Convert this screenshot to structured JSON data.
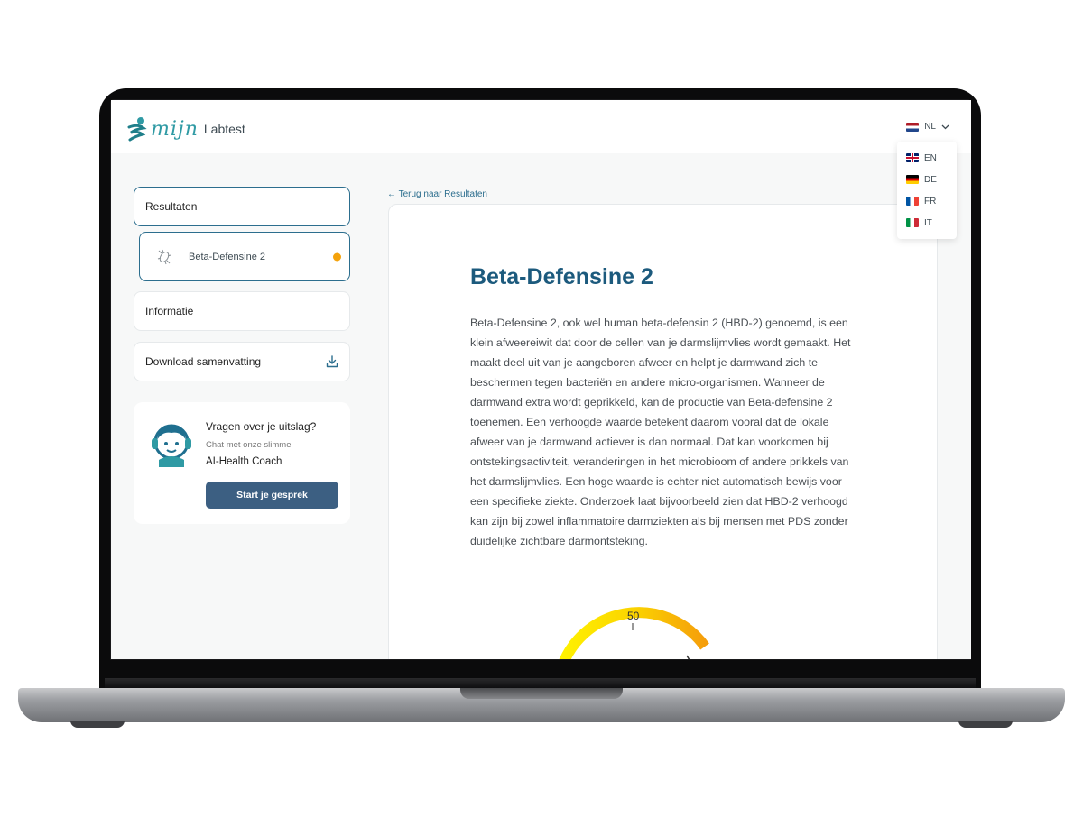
{
  "app": {
    "logo_script": "mijn",
    "logo_text": "Labtest"
  },
  "language": {
    "current": "NL",
    "options": [
      {
        "code": "EN",
        "flag": "uk-flag-icon"
      },
      {
        "code": "DE",
        "flag": "germany-flag-icon"
      },
      {
        "code": "FR",
        "flag": "france-flag-icon"
      },
      {
        "code": "IT",
        "flag": "italy-flag-icon"
      }
    ]
  },
  "sidebar": {
    "results_label": "Resultaten",
    "active_item_label": "Beta-Defensine 2",
    "active_item_status_color": "#f4a20b",
    "info_label": "Informatie",
    "download_label": "Download samenvatting"
  },
  "coach": {
    "title": "Vragen over je uitslag?",
    "subtitle": "Chat met onze slimme",
    "name": "AI-Health Coach",
    "button_label": "Start je gesprek"
  },
  "main": {
    "back_link": "← Terug naar Resultaten",
    "title": "Beta-Defensine 2",
    "body": "Beta-Defensine 2, ook wel human beta-defensin 2 (HBD-2) genoemd, is een klein afweereiwit dat door de cellen van je darmslijmvlies wordt gemaakt. Het maakt deel uit van je aangeboren afweer en helpt je darmwand zich te beschermen tegen bacteriën en andere micro-organismen. Wanneer de darmwand extra wordt geprikkeld, kan de productie van Beta-defensine 2 toenemen. Een verhoogde waarde betekent daarom vooral dat de lokale afweer van je darmwand actiever is dan normaal. Dat kan voorkomen bij ontstekingsactiviteit, veranderingen in het microbioom of andere prikkels van het darmslijmvlies. Een hoge waarde is echter niet automatisch bewijs voor een specifieke ziekte. Onderzoek laat bijvoorbeeld zien dat HBD-2 verhoogd kan zijn bij zowel inflammatoire darmziekten als bij mensen met PDS zonder duidelijke zichtbare darmontsteking.",
    "gauge_label": "50"
  },
  "colors": {
    "accent": "#1c5a7d",
    "button": "#3c5f82",
    "warning": "#f4a20b"
  }
}
